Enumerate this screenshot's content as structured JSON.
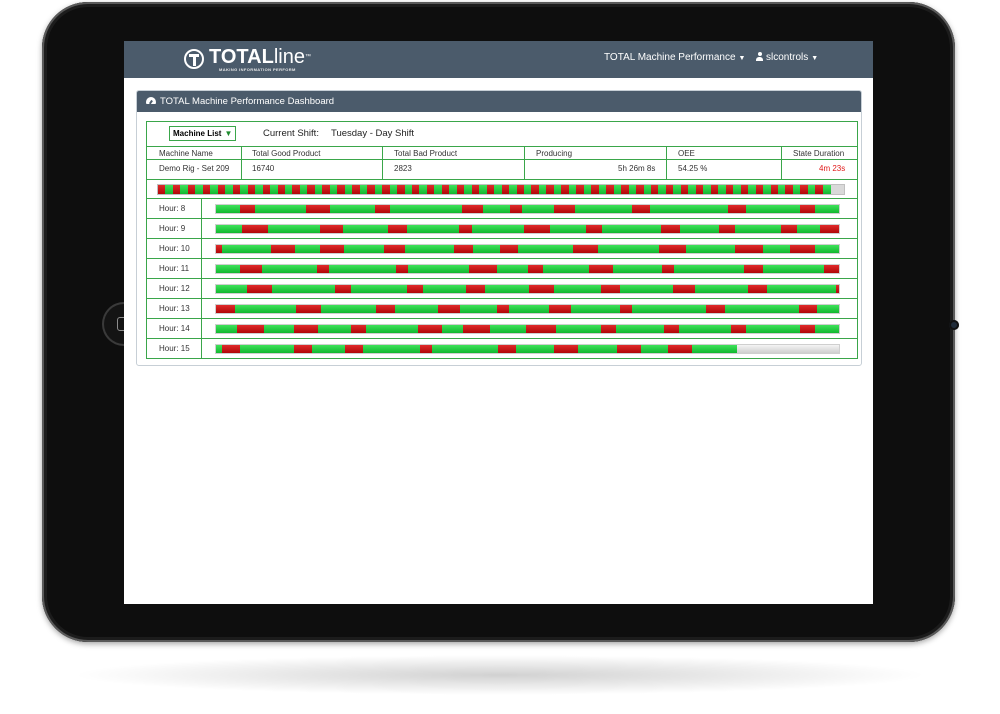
{
  "app": {
    "logo": {
      "brand_bold": "TOTAL",
      "brand_light": "line",
      "trademark": "™",
      "tagline": "MAKING INFORMATION PERFORM"
    },
    "nav": {
      "performance_menu": "TOTAL Machine Performance",
      "user_menu": "slcontrols"
    },
    "icons": [
      "logo-mark-icon",
      "user-icon",
      "caret-down-icon",
      "dashboard-icon",
      "triangle-down-icon",
      "home-button-icon"
    ]
  },
  "colors": {
    "navbar": "#4b5b6b",
    "accent_green": "#3aa64a",
    "producing": "#1ec43c",
    "down": "#c01010",
    "idle": "#d0d0d0",
    "alert_text": "#e01818"
  },
  "panel": {
    "title": "TOTAL Machine Performance Dashboard"
  },
  "filters": {
    "machine_list": "Machine List",
    "current_shift_label": "Current Shift:",
    "current_shift_value": "Tuesday - Day Shift"
  },
  "machine_table": {
    "headers": [
      "Machine Name",
      "Total Good Product",
      "Total Bad Product",
      "Producing",
      "OEE",
      "State Duration"
    ],
    "row": [
      "Demo Rig - Set 209",
      "16740",
      "2823",
      "5h 26m 8s",
      "54.25 %",
      "4m 23s"
    ]
  },
  "shift_overview": {
    "stripes": 90,
    "produced_fraction": 0.98
  },
  "hours": [
    {
      "label": "Hour: 8",
      "segments": [
        [
          "g",
          0.04
        ],
        [
          "r",
          0.025
        ],
        [
          "g",
          0.085
        ],
        [
          "r",
          0.04
        ],
        [
          "g",
          0.075
        ],
        [
          "r",
          0.025
        ],
        [
          "g",
          0.12
        ],
        [
          "r",
          0.035
        ],
        [
          "g",
          0.045
        ],
        [
          "r",
          0.02
        ],
        [
          "g",
          0.055
        ],
        [
          "r",
          0.035
        ],
        [
          "g",
          0.095
        ],
        [
          "r",
          0.03
        ],
        [
          "g",
          0.13
        ],
        [
          "r",
          0.03
        ],
        [
          "g",
          0.09
        ],
        [
          "r",
          0.025
        ],
        [
          "g",
          0.04
        ]
      ]
    },
    {
      "label": "Hour: 9",
      "segments": [
        [
          "g",
          0.04
        ],
        [
          "r",
          0.04
        ],
        [
          "g",
          0.08
        ],
        [
          "r",
          0.035
        ],
        [
          "g",
          0.07
        ],
        [
          "r",
          0.03
        ],
        [
          "g",
          0.08
        ],
        [
          "r",
          0.02
        ],
        [
          "g",
          0.08
        ],
        [
          "r",
          0.04
        ],
        [
          "g",
          0.055
        ],
        [
          "r",
          0.025
        ],
        [
          "g",
          0.09
        ],
        [
          "r",
          0.03
        ],
        [
          "g",
          0.06
        ],
        [
          "r",
          0.025
        ],
        [
          "g",
          0.07
        ],
        [
          "r",
          0.025
        ],
        [
          "g",
          0.035
        ],
        [
          "r",
          0.03
        ],
        [
          "g",
          0.0
        ]
      ]
    },
    {
      "label": "Hour: 10",
      "segments": [
        [
          "r",
          0.01
        ],
        [
          "g",
          0.08
        ],
        [
          "r",
          0.04
        ],
        [
          "g",
          0.04
        ],
        [
          "r",
          0.04
        ],
        [
          "g",
          0.065
        ],
        [
          "r",
          0.035
        ],
        [
          "g",
          0.08
        ],
        [
          "r",
          0.03
        ],
        [
          "g",
          0.045
        ],
        [
          "r",
          0.03
        ],
        [
          "g",
          0.09
        ],
        [
          "r",
          0.04
        ],
        [
          "g",
          0.1
        ],
        [
          "r",
          0.045
        ],
        [
          "g",
          0.08
        ],
        [
          "r",
          0.045
        ],
        [
          "g",
          0.045
        ],
        [
          "r",
          0.04
        ],
        [
          "g",
          0.04
        ]
      ]
    },
    {
      "label": "Hour: 11",
      "segments": [
        [
          "g",
          0.04
        ],
        [
          "r",
          0.035
        ],
        [
          "g",
          0.09
        ],
        [
          "r",
          0.02
        ],
        [
          "g",
          0.11
        ],
        [
          "r",
          0.02
        ],
        [
          "g",
          0.1
        ],
        [
          "r",
          0.045
        ],
        [
          "g",
          0.05
        ],
        [
          "r",
          0.025
        ],
        [
          "g",
          0.075
        ],
        [
          "r",
          0.04
        ],
        [
          "g",
          0.08
        ],
        [
          "r",
          0.02
        ],
        [
          "g",
          0.115
        ],
        [
          "r",
          0.03
        ],
        [
          "g",
          0.1
        ],
        [
          "r",
          0.025
        ],
        [
          "g",
          0.0
        ]
      ]
    },
    {
      "label": "Hour: 12",
      "segments": [
        [
          "g",
          0.05
        ],
        [
          "r",
          0.04
        ],
        [
          "g",
          0.1
        ],
        [
          "r",
          0.025
        ],
        [
          "g",
          0.09
        ],
        [
          "r",
          0.025
        ],
        [
          "g",
          0.07
        ],
        [
          "r",
          0.03
        ],
        [
          "g",
          0.07
        ],
        [
          "r",
          0.04
        ],
        [
          "g",
          0.075
        ],
        [
          "r",
          0.03
        ],
        [
          "g",
          0.085
        ],
        [
          "r",
          0.035
        ],
        [
          "g",
          0.085
        ],
        [
          "r",
          0.03
        ],
        [
          "g",
          0.11
        ],
        [
          "r",
          0.005
        ]
      ]
    },
    {
      "label": "Hour: 13",
      "segments": [
        [
          "r",
          0.03
        ],
        [
          "g",
          0.1
        ],
        [
          "r",
          0.04
        ],
        [
          "g",
          0.09
        ],
        [
          "r",
          0.03
        ],
        [
          "g",
          0.07
        ],
        [
          "r",
          0.035
        ],
        [
          "g",
          0.06
        ],
        [
          "r",
          0.02
        ],
        [
          "g",
          0.065
        ],
        [
          "r",
          0.035
        ],
        [
          "g",
          0.08
        ],
        [
          "r",
          0.02
        ],
        [
          "g",
          0.12
        ],
        [
          "r",
          0.03
        ],
        [
          "g",
          0.12
        ],
        [
          "r",
          0.03
        ],
        [
          "g",
          0.035
        ]
      ]
    },
    {
      "label": "Hour: 14",
      "segments": [
        [
          "g",
          0.035
        ],
        [
          "r",
          0.045
        ],
        [
          "g",
          0.05
        ],
        [
          "r",
          0.04
        ],
        [
          "g",
          0.055
        ],
        [
          "r",
          0.025
        ],
        [
          "g",
          0.085
        ],
        [
          "r",
          0.04
        ],
        [
          "g",
          0.035
        ],
        [
          "r",
          0.045
        ],
        [
          "g",
          0.06
        ],
        [
          "r",
          0.05
        ],
        [
          "g",
          0.075
        ],
        [
          "r",
          0.025
        ],
        [
          "g",
          0.08
        ],
        [
          "r",
          0.025
        ],
        [
          "g",
          0.085
        ],
        [
          "r",
          0.025
        ],
        [
          "g",
          0.09
        ],
        [
          "r",
          0.025
        ],
        [
          "g",
          0.04
        ]
      ]
    },
    {
      "label": "Hour: 15",
      "segments": [
        [
          "g",
          0.01
        ],
        [
          "r",
          0.03
        ],
        [
          "g",
          0.09
        ],
        [
          "r",
          0.03
        ],
        [
          "g",
          0.055
        ],
        [
          "r",
          0.03
        ],
        [
          "g",
          0.095
        ],
        [
          "r",
          0.02
        ],
        [
          "g",
          0.11
        ],
        [
          "r",
          0.03
        ],
        [
          "g",
          0.065
        ],
        [
          "r",
          0.04
        ],
        [
          "g",
          0.065
        ],
        [
          "r",
          0.04
        ],
        [
          "g",
          0.045
        ],
        [
          "r",
          0.04
        ],
        [
          "g",
          0.075
        ],
        [
          "i",
          0.17
        ]
      ]
    }
  ]
}
